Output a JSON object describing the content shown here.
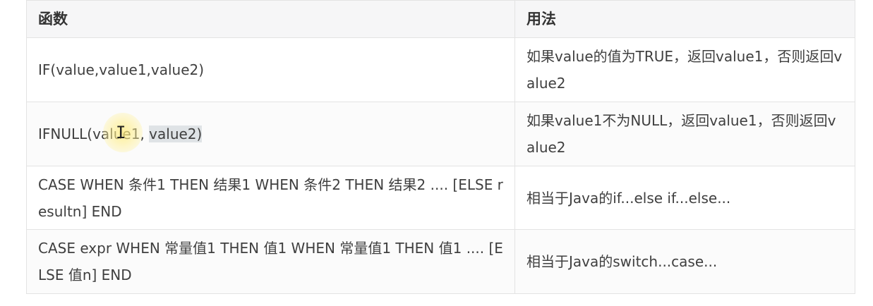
{
  "table": {
    "headers": [
      "函数",
      "用法"
    ],
    "rows": [
      {
        "function": "IF(value,value1,value2)",
        "usage": "如果value的值为TRUE，返回value1，否则返回value2"
      },
      {
        "function_prefix": "IFNULL(value1, ",
        "function_selected": "value2)",
        "usage": "如果value1不为NULL，返回value1，否则返回value2"
      },
      {
        "function": "CASE WHEN 条件1 THEN 结果1 WHEN 条件2 THEN 结果2 .... [ELSE resultn] END",
        "usage": "相当于Java的if...else if...else..."
      },
      {
        "function": "CASE  expr WHEN 常量值1 THEN 值1 WHEN 常量值1 THEN 值1 .... [ELSE 值n] END",
        "usage": "相当于Java的switch...case..."
      }
    ]
  },
  "cursor": {
    "icon": "text-cursor-icon",
    "glyph": "I",
    "highlight_color": "#fff2a0"
  },
  "colors": {
    "border": "#e3e3e3",
    "header_bg": "#f6f6f7",
    "text": "#3f3f3f",
    "selection": "#dfe3e6"
  }
}
